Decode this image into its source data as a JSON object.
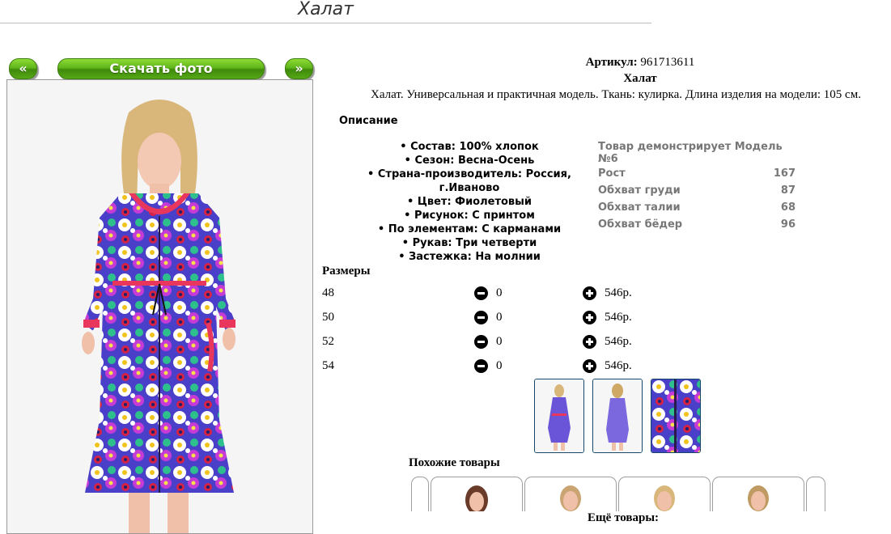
{
  "page": {
    "title": "Халат"
  },
  "nav": {
    "prev_label": "«",
    "download_label": "Скачать фото",
    "next_label": "»"
  },
  "product": {
    "article_label": "Артикул:",
    "article_value": "961713611",
    "name": "Халат",
    "description": "Халат. Универсальная и практичная модель. Ткань: кулирка. Длина изделия на модели: 105 см."
  },
  "description_section": {
    "heading": "Описание",
    "attributes": [
      "Состав: 100% хлопок",
      "Сезон: Весна-Осень",
      "Страна-производитель: Россия, г.Иваново",
      "Цвет: Фиолетовый",
      "Рисунок: С принтом",
      "По элементам: С карманами",
      "Рукав: Три четверти",
      "Застежка: На молнии"
    ]
  },
  "model_info": {
    "header": "Товар демонстрирует Модель №6",
    "rows": [
      {
        "label": "Рост",
        "value": "167"
      },
      {
        "label": "Обхват груди",
        "value": "87"
      },
      {
        "label": "Обхват талии",
        "value": "68"
      },
      {
        "label": "Обхват бёдер",
        "value": "96"
      }
    ]
  },
  "sizes_section": {
    "heading": "Размеры",
    "rows": [
      {
        "size": "48",
        "qty": "0",
        "price": "546р."
      },
      {
        "size": "50",
        "qty": "0",
        "price": "546р."
      },
      {
        "size": "52",
        "qty": "0",
        "price": "546р."
      },
      {
        "size": "54",
        "qty": "0",
        "price": "546р."
      }
    ]
  },
  "similar": {
    "heading": "Похожие товары"
  },
  "more": {
    "heading": "Ещё товары:"
  },
  "colors": {
    "button_green": "#5fb51a",
    "thumb_border": "#17486b",
    "dress_base": "#5a3fd0",
    "dress_trim": "#e8365c"
  }
}
